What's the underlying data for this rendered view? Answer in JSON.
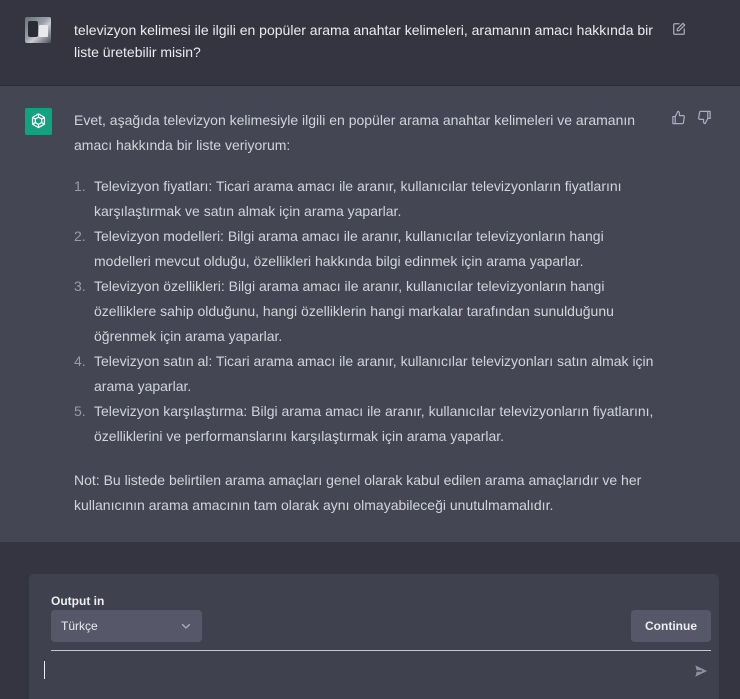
{
  "user_message": {
    "text": "televizyon kelimesi ile ilgili en popüler arama anahtar kelimeleri, aramanın amacı hakkında bir liste üretebilir misin?"
  },
  "assistant_message": {
    "intro": "Evet, aşağıda televizyon kelimesiyle ilgili en popüler arama anahtar kelimeleri ve aramanın amacı hakkında bir liste veriyorum:",
    "items": [
      {
        "num": "1.",
        "text": "Televizyon fiyatları: Ticari arama amacı ile aranır, kullanıcılar televizyonların fiyatlarını karşılaştırmak ve satın almak için arama yaparlar."
      },
      {
        "num": "2.",
        "text": "Televizyon modelleri: Bilgi arama amacı ile aranır, kullanıcılar televizyonların hangi modelleri mevcut olduğu, özellikleri hakkında bilgi edinmek için arama yaparlar."
      },
      {
        "num": "3.",
        "text": "Televizyon özellikleri: Bilgi arama amacı ile aranır, kullanıcılar televizyonların hangi özelliklere sahip olduğunu, hangi özelliklerin hangi markalar tarafından sunulduğunu öğrenmek için arama yaparlar."
      },
      {
        "num": "4.",
        "text": "Televizyon satın al: Ticari arama amacı ile aranır, kullanıcılar televizyonları satın almak için arama yaparlar."
      },
      {
        "num": "5.",
        "text": "Televizyon karşılaştırma: Bilgi arama amacı ile aranır, kullanıcılar televizyonların fiyatlarını, özelliklerini ve performanslarını karşılaştırmak için arama yaparlar."
      }
    ],
    "note": "Not: Bu listede belirtilen arama amaçları genel olarak kabul edilen arama amaçlarıdır ve her kullanıcının arama amacının tam olarak aynı olmayabileceği unutulmamalıdır."
  },
  "composer": {
    "output_label": "Output in",
    "language_selected": "Türkçe",
    "continue_label": "Continue",
    "input_value": ""
  },
  "colors": {
    "background": "#343541",
    "assistant_bg": "#444654",
    "brand_green": "#10a37f",
    "panel_bg": "#40414f",
    "button_bg": "#565869"
  },
  "icons": {
    "edit": "edit-icon",
    "thumbs_up": "thumbs-up-icon",
    "thumbs_down": "thumbs-down-icon",
    "logo": "openai-logo-icon",
    "chevron": "chevron-down-icon",
    "send": "send-icon"
  }
}
